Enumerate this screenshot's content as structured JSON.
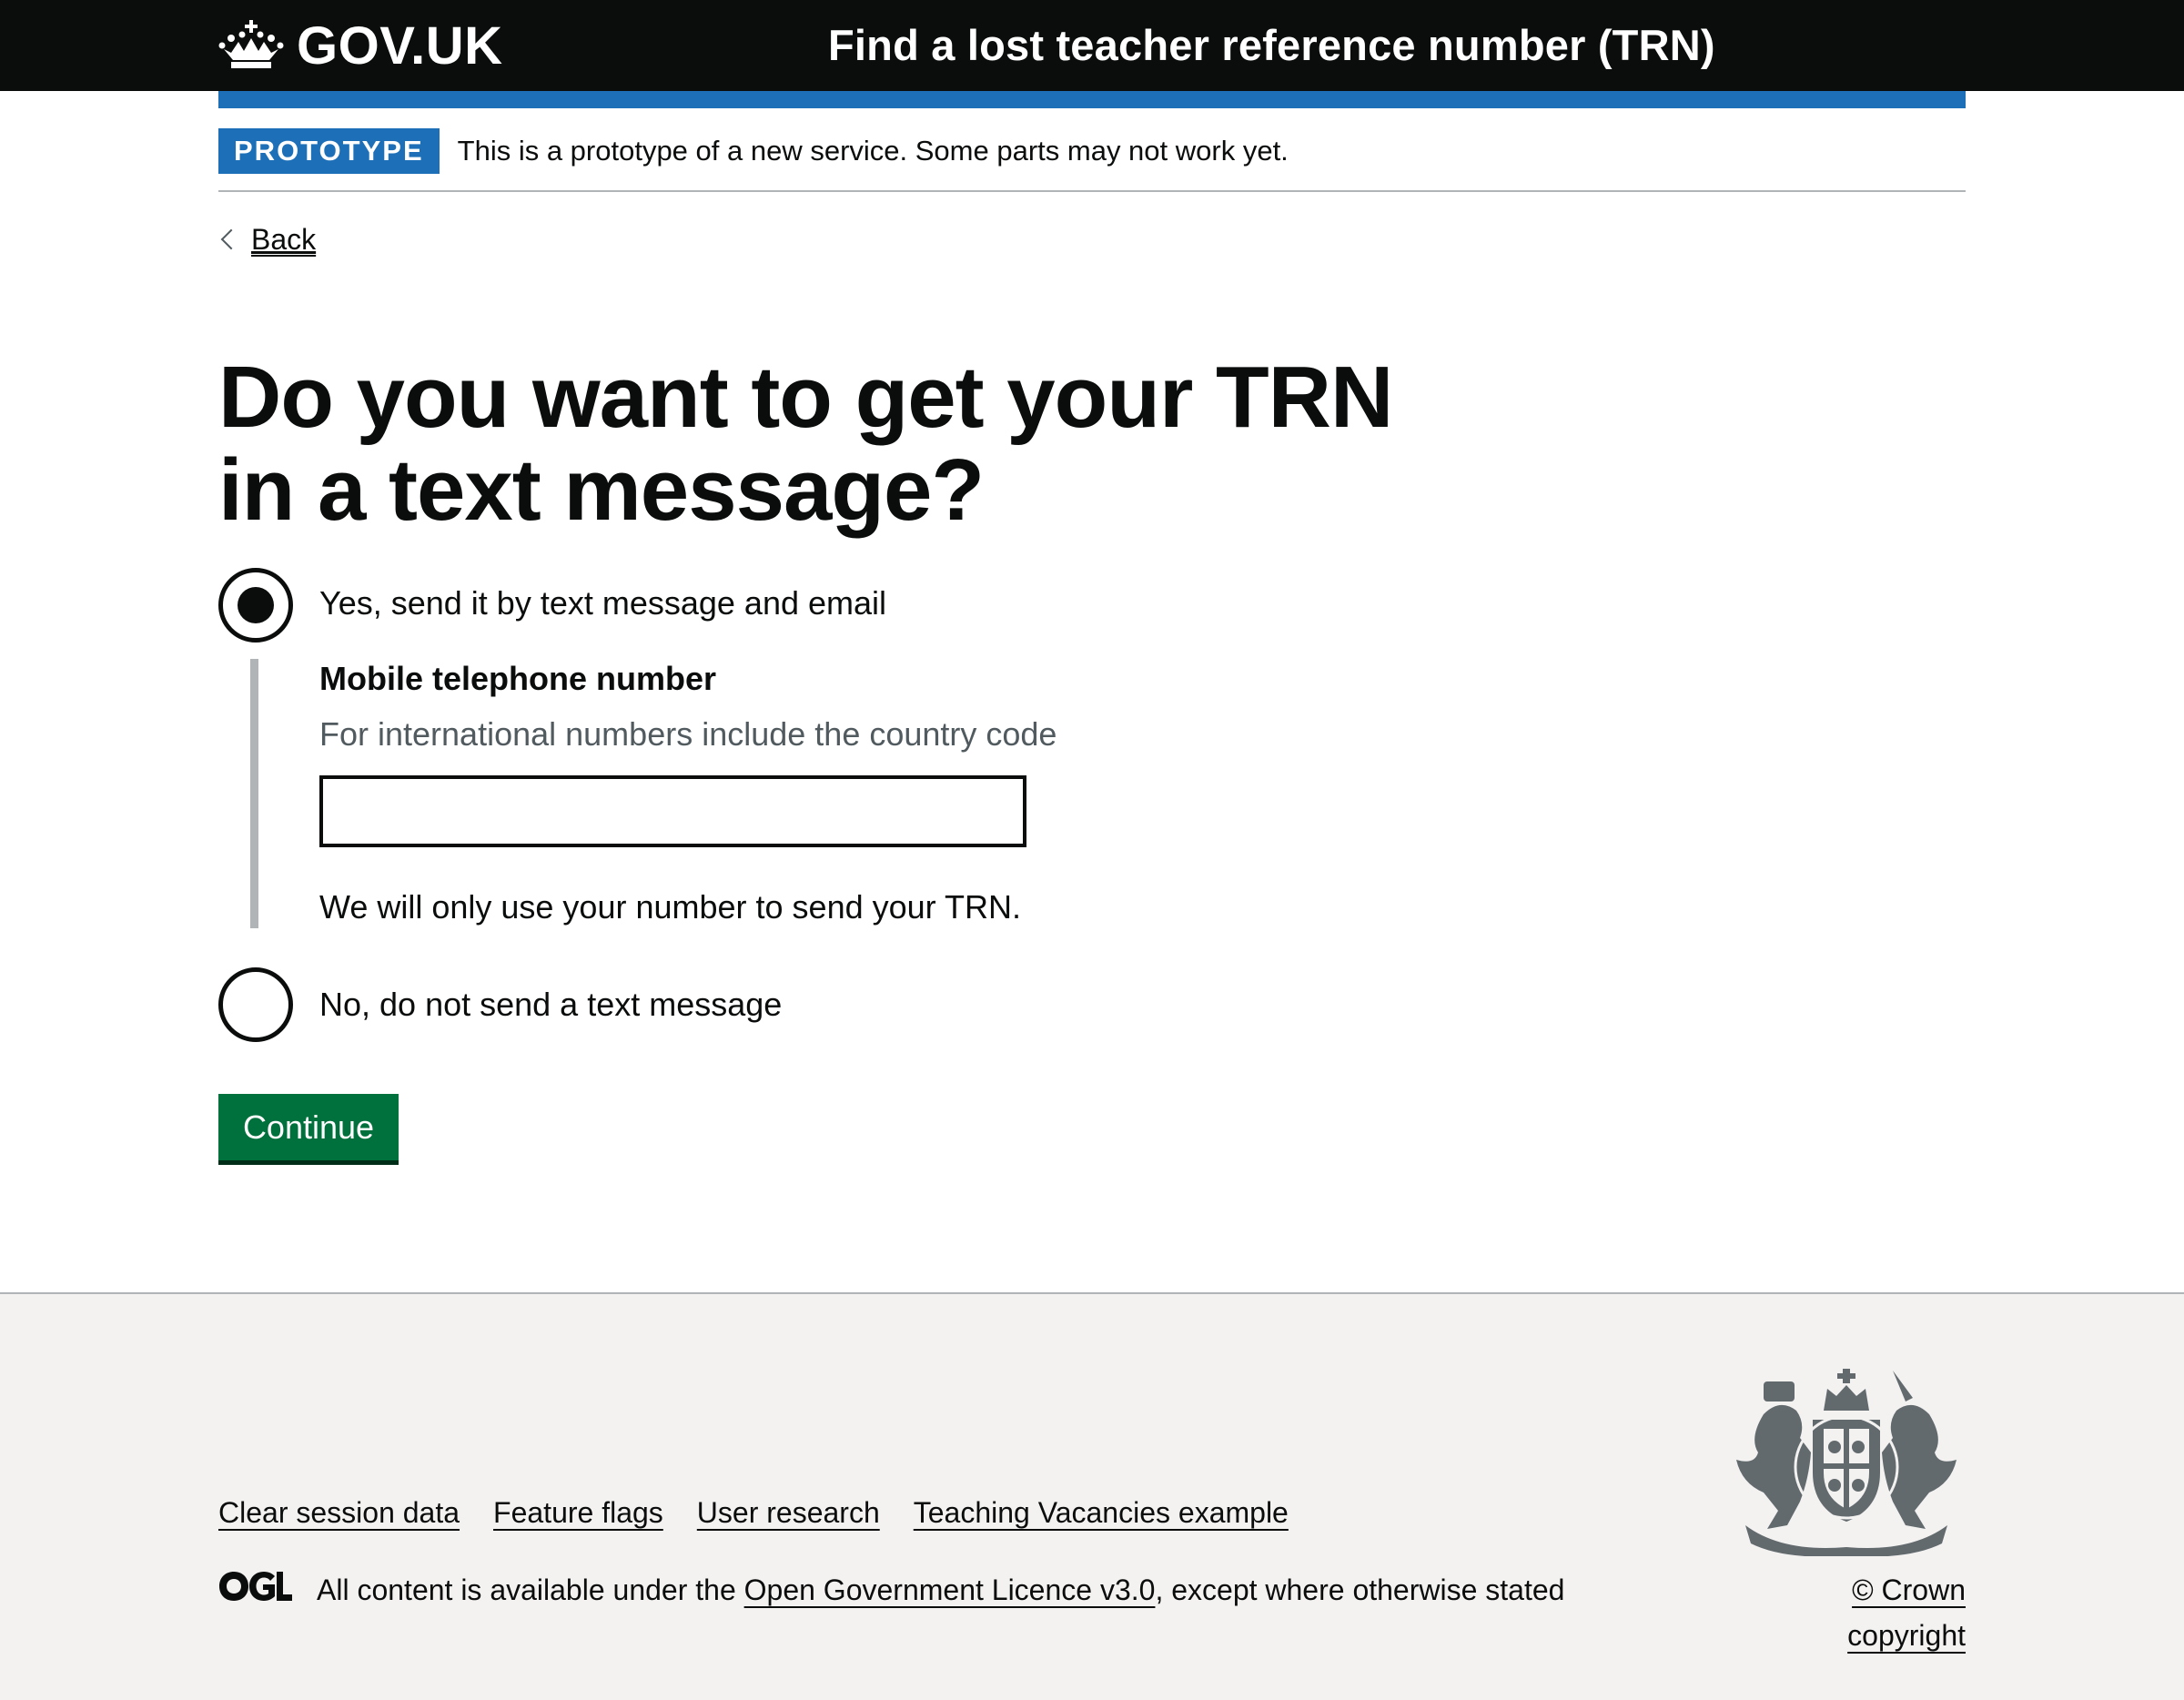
{
  "header": {
    "logo_text": "GOV.UK",
    "service_name": "Find a lost teacher reference number (TRN)"
  },
  "phase_banner": {
    "tag": "PROTOTYPE",
    "text": "This is a prototype of a new service. Some parts may not work yet."
  },
  "back_link": "Back",
  "question": {
    "heading": "Do you want to get your TRN in a text message?",
    "options": [
      {
        "label": "Yes, send it by text message and email",
        "selected": true
      },
      {
        "label": "No, do not send a text message",
        "selected": false
      }
    ],
    "conditional": {
      "label": "Mobile telephone number",
      "hint": "For international numbers include the country code",
      "value": "",
      "note": "We will only use your number to send your TRN."
    }
  },
  "continue_button": "Continue",
  "footer": {
    "links": [
      "Clear session data",
      "Feature flags",
      "User research",
      "Teaching Vacancies example"
    ],
    "licence_prefix": "All content is available under the ",
    "licence_link": "Open Government Licence v3.0",
    "licence_suffix": ", except where otherwise stated",
    "copyright": "© Crown copyright"
  },
  "colors": {
    "header_bg": "#0b0c0c",
    "brand_blue": "#1d70b8",
    "button_green": "#00703c",
    "footer_bg": "#f3f2f1",
    "hint_grey": "#505a5f"
  },
  "icons": [
    "crown-icon",
    "chevron-left-icon",
    "ogl-logo-icon",
    "royal-coat-of-arms-icon"
  ]
}
